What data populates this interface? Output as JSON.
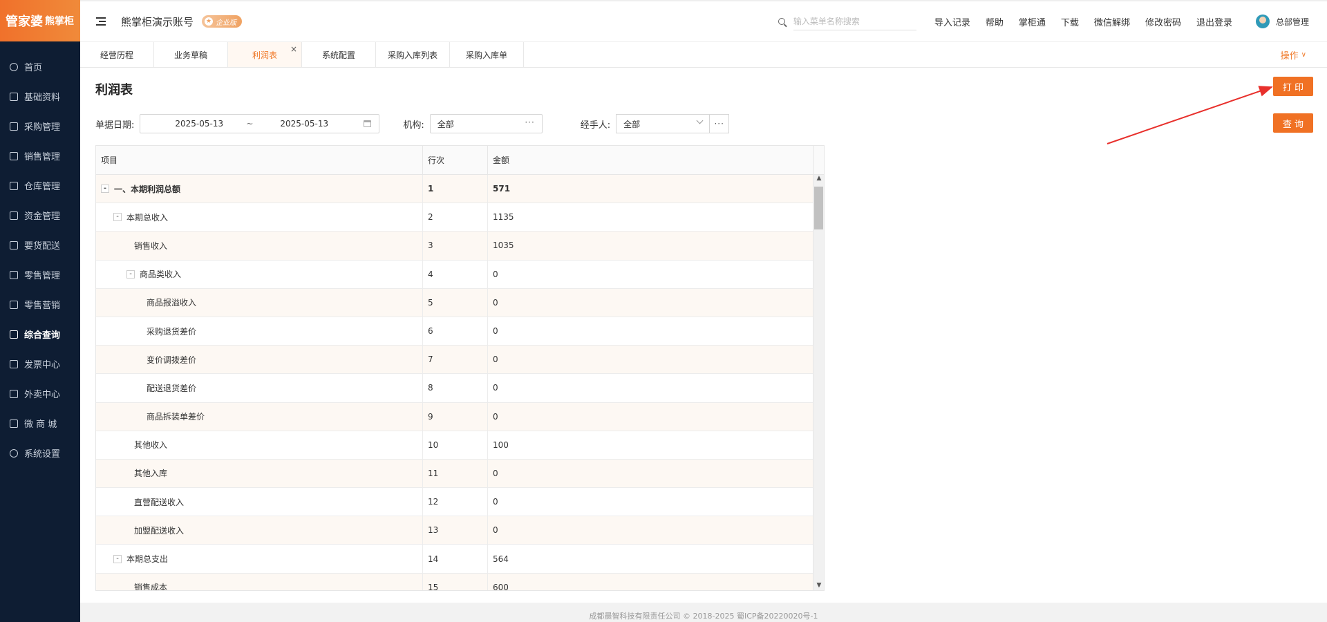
{
  "logo": {
    "brand": "管家婆",
    "product": "熊掌柜"
  },
  "sidebar": {
    "items": [
      {
        "label": "首页"
      },
      {
        "label": "基础资料"
      },
      {
        "label": "采购管理"
      },
      {
        "label": "销售管理"
      },
      {
        "label": "仓库管理"
      },
      {
        "label": "资金管理"
      },
      {
        "label": "要货配送"
      },
      {
        "label": "零售管理"
      },
      {
        "label": "零售营销"
      },
      {
        "label": "综合查询"
      },
      {
        "label": "发票中心"
      },
      {
        "label": "外卖中心"
      },
      {
        "label": "微 商 城"
      },
      {
        "label": "系统设置"
      }
    ],
    "active_index": 9
  },
  "header": {
    "account_name": "熊掌柜演示账号",
    "badge": "企业版",
    "search_placeholder": "输入菜单名称搜索",
    "links": [
      "导入记录",
      "帮助",
      "掌柜通",
      "下载",
      "微信解绑",
      "修改密码",
      "退出登录"
    ],
    "user_name": "总部管理"
  },
  "tabs": {
    "items": [
      "经营历程",
      "业务草稿",
      "利润表",
      "系统配置",
      "采购入库列表",
      "采购入库单"
    ],
    "active_index": 2,
    "close_glyph": "×",
    "operation_label": "操作",
    "operation_chevron": "∨"
  },
  "page": {
    "title": "利润表",
    "print_label": "打 印",
    "query_label": "查 询"
  },
  "filters": {
    "date_label": "单据日期:",
    "date_from": "2025-05-13",
    "date_sep": "~",
    "date_to": "2025-05-13",
    "org_label": "机构:",
    "org_value": "全部",
    "org_more": "···",
    "handler_label": "经手人:",
    "handler_value": "全部",
    "handler_more": "···"
  },
  "table": {
    "headers": [
      "项目",
      "行次",
      "金额"
    ],
    "rows": [
      {
        "item": "一、本期利润总额",
        "line": "1",
        "amount": "571",
        "level": 0,
        "toggle": "-",
        "bold": true
      },
      {
        "item": "本期总收入",
        "line": "2",
        "amount": "1135",
        "level": 1,
        "toggle": "-",
        "bold": false
      },
      {
        "item": "销售收入",
        "line": "3",
        "amount": "1035",
        "level": 2,
        "toggle": "",
        "bold": false
      },
      {
        "item": "商品类收入",
        "line": "4",
        "amount": "0",
        "level": 2,
        "toggle": "-",
        "bold": false
      },
      {
        "item": "商品报溢收入",
        "line": "5",
        "amount": "0",
        "level": 3,
        "toggle": "",
        "bold": false
      },
      {
        "item": "采购退货差价",
        "line": "6",
        "amount": "0",
        "level": 3,
        "toggle": "",
        "bold": false
      },
      {
        "item": "变价调拨差价",
        "line": "7",
        "amount": "0",
        "level": 3,
        "toggle": "",
        "bold": false
      },
      {
        "item": "配送退货差价",
        "line": "8",
        "amount": "0",
        "level": 3,
        "toggle": "",
        "bold": false
      },
      {
        "item": "商品拆装单差价",
        "line": "9",
        "amount": "0",
        "level": 3,
        "toggle": "",
        "bold": false
      },
      {
        "item": "其他收入",
        "line": "10",
        "amount": "100",
        "level": 2,
        "toggle": "",
        "bold": false
      },
      {
        "item": "其他入库",
        "line": "11",
        "amount": "0",
        "level": 2,
        "toggle": "",
        "bold": false
      },
      {
        "item": "直营配送收入",
        "line": "12",
        "amount": "0",
        "level": 2,
        "toggle": "",
        "bold": false
      },
      {
        "item": "加盟配送收入",
        "line": "13",
        "amount": "0",
        "level": 2,
        "toggle": "",
        "bold": false
      },
      {
        "item": "本期总支出",
        "line": "14",
        "amount": "564",
        "level": 1,
        "toggle": "-",
        "bold": false
      },
      {
        "item": "销售成本",
        "line": "15",
        "amount": "600",
        "level": 2,
        "toggle": "",
        "bold": false
      }
    ]
  },
  "footer": {
    "text": "成都晨智科技有限责任公司 © 2018-2025 蜀ICP备20220020号-1"
  },
  "colors": {
    "accent": "#f07124",
    "sidebar_bg": "#0e1d33",
    "annotation_arrow": "#e8302c"
  }
}
